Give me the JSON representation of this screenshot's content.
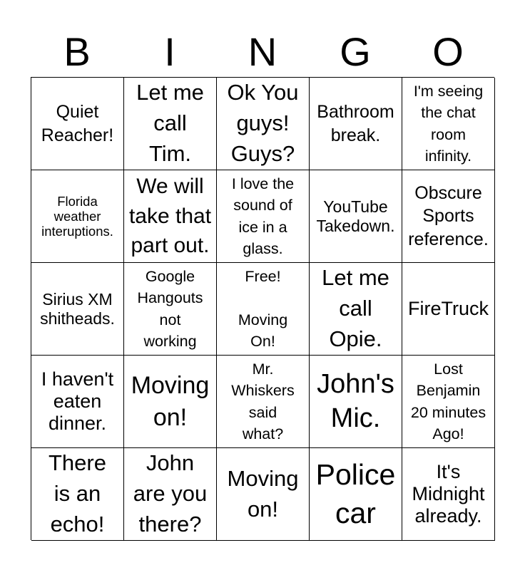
{
  "header": {
    "letters": [
      "B",
      "I",
      "N",
      "G",
      "O"
    ]
  },
  "card": {
    "rows": [
      [
        "Quiet\nReacher!",
        "Let me\ncall\nTim.",
        "Ok You\nguys!\nGuys?",
        "Bathroom\nbreak.",
        "I'm seeing\nthe chat\nroom\ninfinity."
      ],
      [
        "Florida\nweather\ninteruptions.",
        "We will\ntake that\npart out.",
        "I love the\nsound of\nice in a\nglass.",
        "YouTube\nTakedown.",
        "Obscure\nSports\nreference."
      ],
      [
        "Sirius XM\nshitheads.",
        "Google\nHangouts\nnot\nworking",
        "Free!\n\nMoving\nOn!",
        "Let me\ncall\nOpie.",
        "FireTruck"
      ],
      [
        "I haven't\neaten\ndinner.",
        "Moving\non!",
        "Mr.\nWhiskers\nsaid\nwhat?",
        "John's\nMic.",
        "Lost\nBenjamin\n20 minutes\nAgo!"
      ],
      [
        "There\nis an\necho!",
        "John\nare you\nthere?",
        "Moving\non!",
        "Police\ncar",
        "It's\nMidnight\nalready."
      ]
    ]
  }
}
